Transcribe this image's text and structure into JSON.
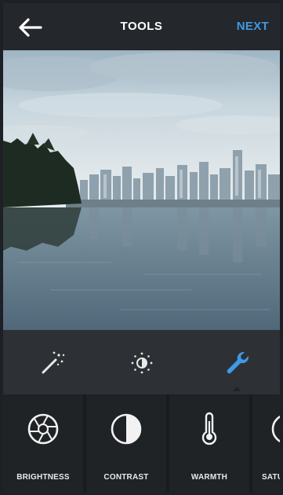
{
  "header": {
    "title": "TOOLS",
    "next_label": "NEXT",
    "back_icon": "arrow-left-icon",
    "accent_color": "#3e9ae6"
  },
  "photo": {
    "subject": "city skyline across calm water under cloudy sky"
  },
  "tool_tabs": [
    {
      "icon": "magic-wand-icon",
      "selected": false
    },
    {
      "icon": "brightness-sun-icon",
      "selected": false
    },
    {
      "icon": "wrench-icon",
      "selected": true
    }
  ],
  "tools": [
    {
      "label": "BRIGHTNESS",
      "icon": "aperture-icon"
    },
    {
      "label": "CONTRAST",
      "icon": "half-circle-icon"
    },
    {
      "label": "WARMTH",
      "icon": "thermometer-icon"
    },
    {
      "label": "SATU",
      "icon": "saturation-icon"
    }
  ]
}
